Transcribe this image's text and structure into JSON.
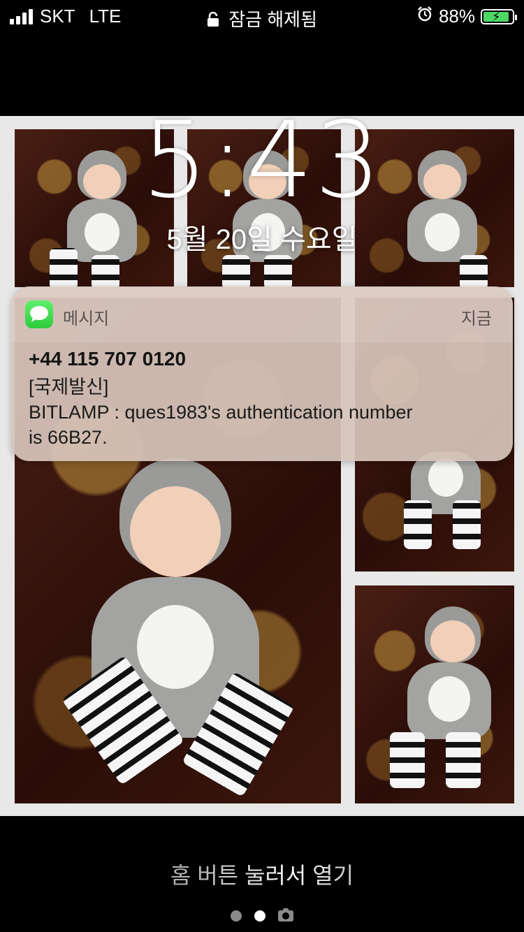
{
  "status_bar": {
    "carrier": "SKT",
    "network": "LTE",
    "lock_status": "잠금 해제됨",
    "battery_percent": "88%",
    "signal_bars": 4,
    "icons": [
      "signal-icon",
      "lock-icon",
      "alarm-icon",
      "battery-charging-icon"
    ]
  },
  "lock_screen": {
    "time": "5:43",
    "date": "5월 20일 수요일"
  },
  "notification": {
    "app_name": "메시지",
    "time": "지금",
    "title": "+44 115 707 0120",
    "lines": [
      "[국제발신]",
      "BITLAMP : ques1983's authentication number",
      "is 66B27."
    ],
    "app_icon": "messages-icon",
    "app_color": "#34c759"
  },
  "bottom": {
    "unlock_hint": "홈 버튼 눌러서 열기",
    "page_dots": [
      {
        "state": "inactive",
        "color": "#8a8a8a"
      },
      {
        "state": "active",
        "color": "#ffffff"
      }
    ],
    "camera_icon": "camera-icon"
  },
  "wallpaper": {
    "description_icon": "wallpaper-photo-collage",
    "tile_count": 6
  },
  "colors": {
    "battery_fill": "#4cd964",
    "notification_bg": "#d6c4ba"
  }
}
